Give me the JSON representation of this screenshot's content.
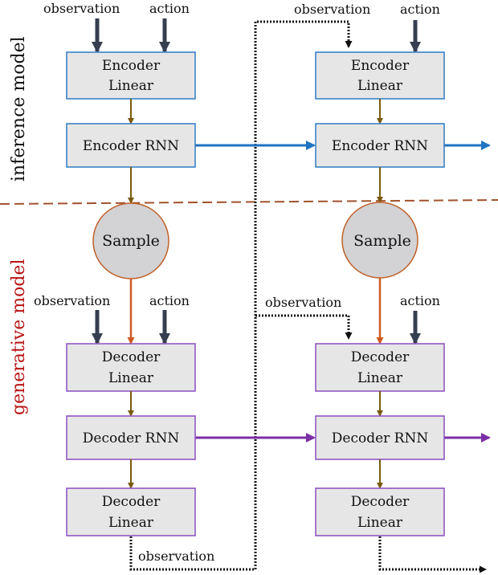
{
  "side_labels": {
    "inference": "inference model",
    "generative": "generative model"
  },
  "colors": {
    "encoder_border": "#2e7bc4",
    "decoder_border": "#8a4fbf",
    "box_fill": "#e6e6e6",
    "internal_arrow": "#7a5a10",
    "input_arrow": "#363f4f",
    "encoder_rnn_arrow": "#1f73c0",
    "decoder_rnn_arrow": "#7a2fa6",
    "sample_border": "#c0612a",
    "sample_fill": "#d3d2d4",
    "sample_arrow": "#cf5a23",
    "divider": "#a0522d",
    "generative_label": "#b81414",
    "inference_label": "#111111",
    "dotted": "#111111"
  },
  "steps": [
    {
      "inputs": {
        "observation": "observation",
        "action": "action"
      },
      "encoder_linear": [
        "Encoder",
        "Linear"
      ],
      "encoder_rnn": "Encoder RNN",
      "sample": "Sample",
      "decoder_inputs": {
        "observation": "observation",
        "action": "action"
      },
      "decoder_linear": [
        "Decoder",
        "Linear"
      ],
      "decoder_rnn": "Decoder RNN",
      "decoder_out": [
        "Decoder",
        "Linear"
      ],
      "output_label": "observation"
    },
    {
      "inputs": {
        "observation": "observation",
        "action": "action"
      },
      "encoder_linear": [
        "Encoder",
        "Linear"
      ],
      "encoder_rnn": "Encoder RNN",
      "sample": "Sample",
      "decoder_inputs": {
        "observation": "observation",
        "action": "action"
      },
      "decoder_linear": [
        "Decoder",
        "Linear"
      ],
      "decoder_rnn": "Decoder RNN",
      "decoder_out": [
        "Decoder",
        "Linear"
      ]
    }
  ]
}
